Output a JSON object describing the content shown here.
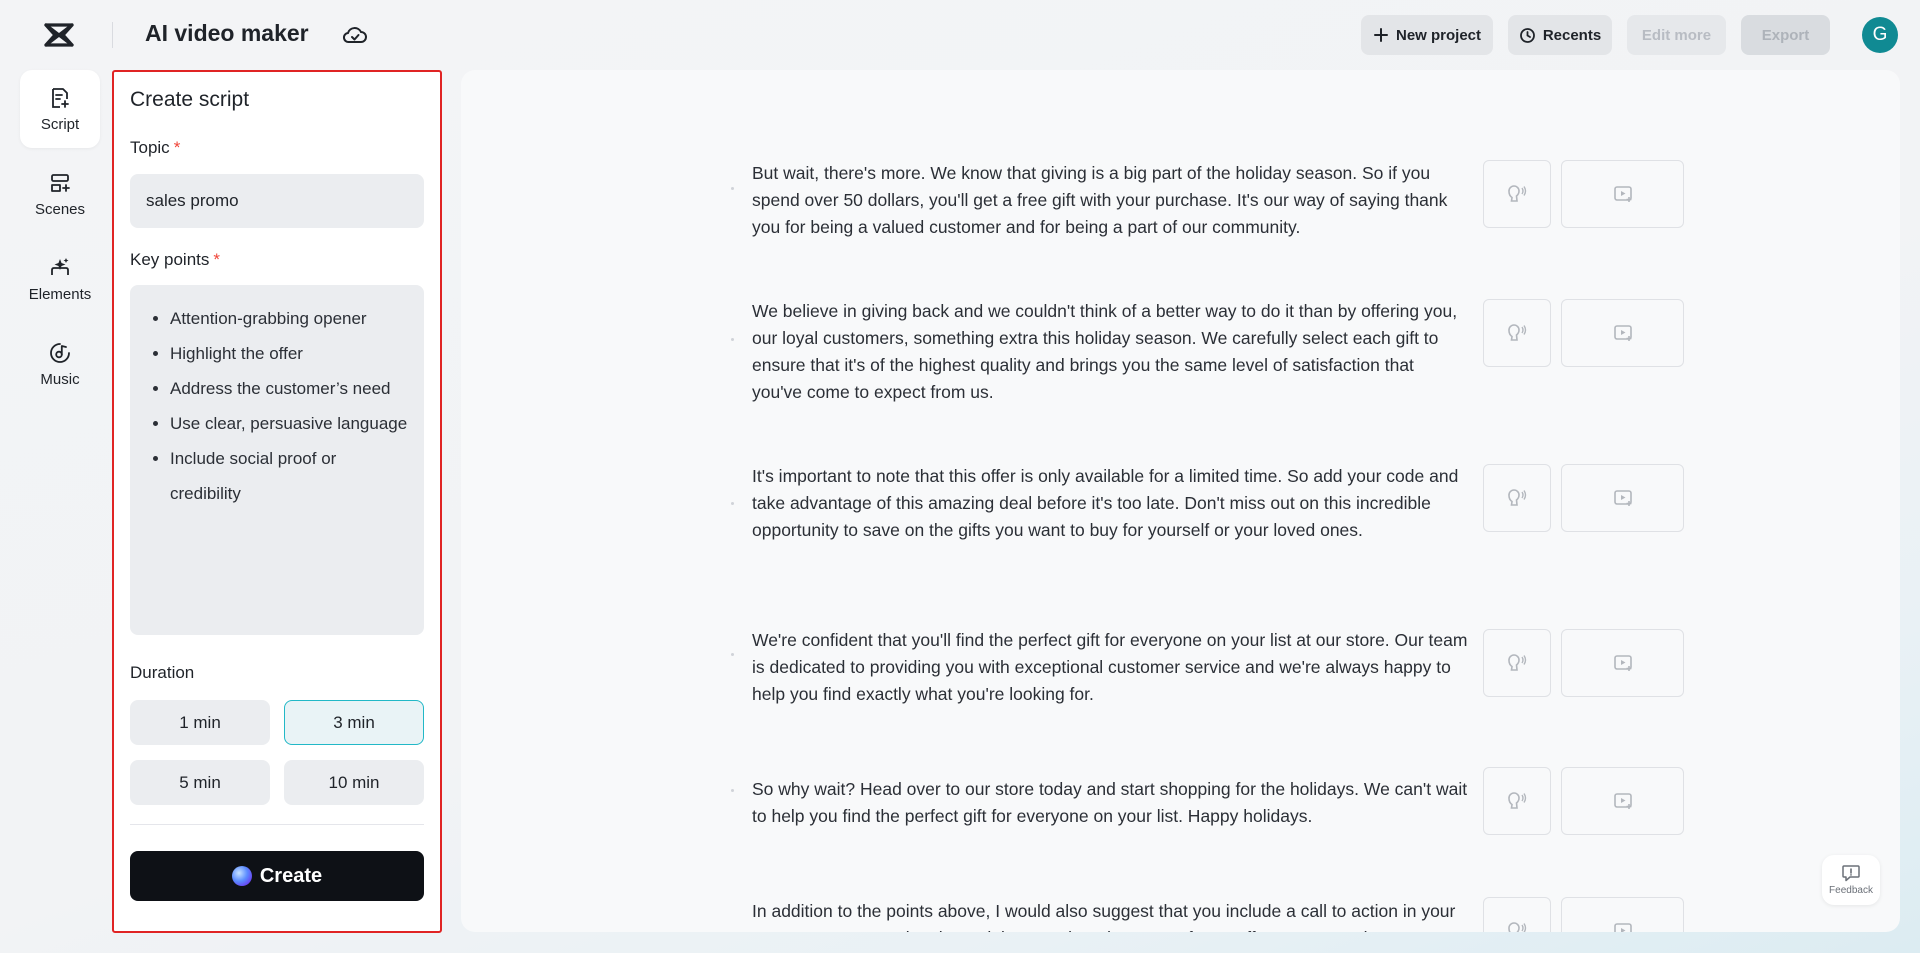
{
  "app": {
    "title": "AI video maker"
  },
  "header": {
    "new_project": "New project",
    "recents": "Recents",
    "edit_more": "Edit more",
    "export": "Export",
    "avatar_letter": "G"
  },
  "rail": {
    "items": [
      {
        "label": "Script",
        "icon": "script-icon",
        "active": true
      },
      {
        "label": "Scenes",
        "icon": "scenes-icon"
      },
      {
        "label": "Elements",
        "icon": "elements-icon"
      },
      {
        "label": "Music",
        "icon": "music-icon"
      }
    ]
  },
  "panel": {
    "title": "Create script",
    "topic_label": "Topic",
    "topic_value": "sales promo",
    "keypoints_label": "Key points",
    "required_mark": "*",
    "keypoints": [
      "Attention-grabbing opener",
      "Highlight the offer",
      "Address the customer’s need",
      "Use clear, persuasive language",
      "Include social proof or credibility"
    ],
    "duration_label": "Duration",
    "durations": [
      "1 min",
      "3 min",
      "5 min",
      "10 min"
    ],
    "selected_duration": "3 min",
    "create_label": "Create"
  },
  "script": {
    "paragraphs": [
      "But wait, there's more. We know that giving is a big part of the holiday season. So if you spend over 50 dollars, you'll get a free gift with your purchase. It's our way of saying thank you for being a valued customer and for being a part of our community.",
      "We believe in giving back and we couldn't think of a better way to do it than by offering you, our loyal customers, something extra this holiday season. We carefully select each gift to ensure that it's of the highest quality and brings you the same level of satisfaction that you've come to expect from us.",
      "It's important to note that this offer is only available for a limited time. So add your code and take advantage of this amazing deal before it's too late. Don't miss out on this incredible opportunity to save on the gifts you want to buy for yourself or your loved ones.",
      "We're confident that you'll find the perfect gift for everyone on your list at our store. Our team is dedicated to providing you with exceptional customer service and we're always happy to help you find exactly what you're looking for.",
      "So why wait? Head over to our store today and start shopping for the holidays. We can't wait to help you find the perfect gift for everyone on your list. Happy holidays.",
      "In addition to the points above, I would also suggest that you include a call to action in your message, encouraging the recipient to take advantage of your offer. For example,"
    ]
  },
  "feedback": {
    "label": "Feedback"
  }
}
